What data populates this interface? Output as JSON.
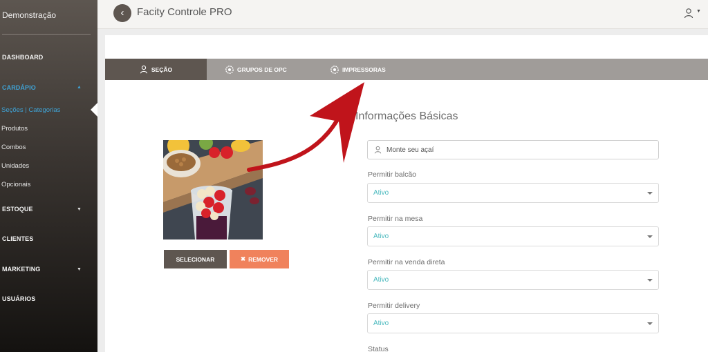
{
  "sidebar": {
    "brand": "Demonstração",
    "nav": {
      "dashboard": "DASHBOARD",
      "cardapio": "CARDÁPIO",
      "estoque": "ESTOQUE",
      "clientes": "CLIENTES",
      "marketing": "MARKETING",
      "usuarios": "USUÁRIOS"
    },
    "cardapio_items": [
      "Seções | Categorias",
      "Produtos",
      "Combos",
      "Unidades",
      "Opcionais"
    ],
    "active_item": "Seções | Categorias",
    "accent_color": "#3fa3d6"
  },
  "header": {
    "title": "Facity Controle PRO",
    "back_icon": "chevron-left-icon",
    "user_icon": "user-icon"
  },
  "tabs": [
    {
      "label": "SEÇÃO",
      "icon": "user-icon",
      "active": true
    },
    {
      "label": "GRUPOS DE OPC",
      "icon": "gear-icon",
      "active": false
    },
    {
      "label": "IMPRESSORAS",
      "icon": "gear-icon",
      "active": false
    }
  ],
  "image_panel": {
    "select_label": "SELECIONAR",
    "remove_label": "REMOVER",
    "remove_icon": "close-icon"
  },
  "form": {
    "section_title": "Informações Básicas",
    "name_value": "Monte seu açaí",
    "fields": [
      {
        "label": "Permitir balcão",
        "value": "Ativo"
      },
      {
        "label": "Permitir na mesa",
        "value": "Ativo"
      },
      {
        "label": "Permitir na venda direta",
        "value": "Ativo"
      },
      {
        "label": "Permitir delivery",
        "value": "Ativo"
      }
    ],
    "status_label": "Status"
  },
  "annotation": {
    "arrow_color": "#c0141b"
  }
}
